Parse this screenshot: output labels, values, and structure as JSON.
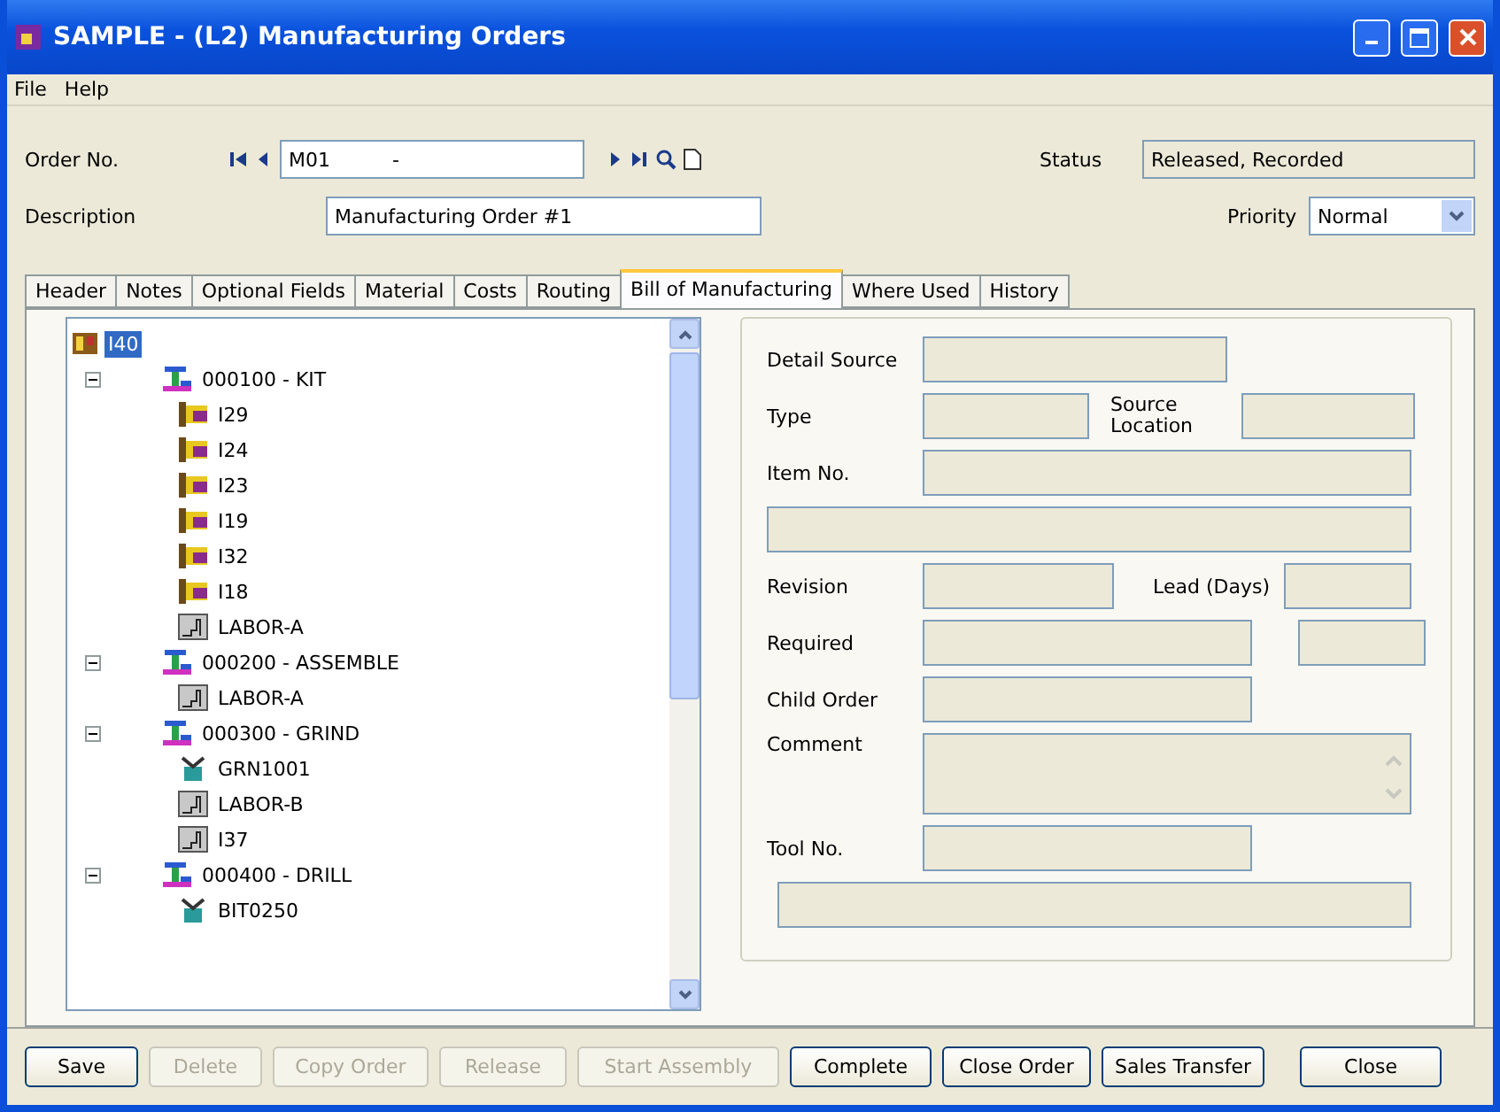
{
  "window": {
    "title": "SAMPLE - (L2) Manufacturing Orders"
  },
  "menu": [
    "File",
    "Help"
  ],
  "order": {
    "label": "Order No.",
    "value": "M01          -"
  },
  "description": {
    "label": "Description",
    "value": "Manufacturing Order #1"
  },
  "status": {
    "label": "Status",
    "value": "Released, Recorded"
  },
  "priority": {
    "label": "Priority",
    "value": "Normal"
  },
  "tabs": [
    {
      "label": "Header",
      "selected": false
    },
    {
      "label": "Notes",
      "selected": false
    },
    {
      "label": "Optional Fields",
      "selected": false
    },
    {
      "label": "Material",
      "selected": false
    },
    {
      "label": "Costs",
      "selected": false
    },
    {
      "label": "Routing",
      "selected": false
    },
    {
      "label": "Bill of Manufacturing",
      "selected": true
    },
    {
      "label": "Where Used",
      "selected": false
    },
    {
      "label": "History",
      "selected": false
    }
  ],
  "tree": [
    {
      "label": "I40",
      "kind": "root",
      "selected": true,
      "children": [
        {
          "label": "000100 - KIT",
          "kind": "step",
          "selected": false,
          "expanded": true,
          "children": [
            {
              "label": "I29",
              "kind": "material",
              "selected": false
            },
            {
              "label": "I24",
              "kind": "material",
              "selected": false
            },
            {
              "label": "I23",
              "kind": "material",
              "selected": false
            },
            {
              "label": "I19",
              "kind": "material",
              "selected": false
            },
            {
              "label": "I32",
              "kind": "material",
              "selected": false
            },
            {
              "label": "I18",
              "kind": "material",
              "selected": false
            },
            {
              "label": "LABOR-A",
              "kind": "labor",
              "selected": false
            }
          ]
        },
        {
          "label": "000200 - ASSEMBLE",
          "kind": "step",
          "selected": false,
          "expanded": true,
          "children": [
            {
              "label": "LABOR-A",
              "kind": "labor",
              "selected": false
            }
          ]
        },
        {
          "label": "000300 - GRIND",
          "kind": "step",
          "selected": false,
          "expanded": true,
          "children": [
            {
              "label": "GRN1001",
              "kind": "tool",
              "selected": false
            },
            {
              "label": "LABOR-B",
              "kind": "labor",
              "selected": false
            },
            {
              "label": "I37",
              "kind": "labor",
              "selected": false
            }
          ]
        },
        {
          "label": "000400 - DRILL",
          "kind": "step",
          "selected": false,
          "expanded": true,
          "children": [
            {
              "label": "BIT0250",
              "kind": "tool",
              "selected": false
            }
          ]
        }
      ]
    }
  ],
  "detail": {
    "detail_source": "Detail Source",
    "type": "Type",
    "source_location": "Source Location",
    "item_no": "Item No.",
    "revision": "Revision",
    "lead_days": "Lead (Days)",
    "required": "Required",
    "child_order": "Child Order",
    "comment": "Comment",
    "tool_no": "Tool No."
  },
  "buttons": [
    {
      "label": "Save",
      "disabled": false
    },
    {
      "label": "Delete",
      "disabled": true
    },
    {
      "label": "Copy Order",
      "disabled": true
    },
    {
      "label": "Release",
      "disabled": true
    },
    {
      "label": "Start Assembly",
      "disabled": true
    },
    {
      "label": "Complete",
      "disabled": false
    },
    {
      "label": "Close Order",
      "disabled": false
    },
    {
      "label": "Sales Transfer",
      "disabled": false
    },
    {
      "label": "Close",
      "disabled": false
    }
  ]
}
